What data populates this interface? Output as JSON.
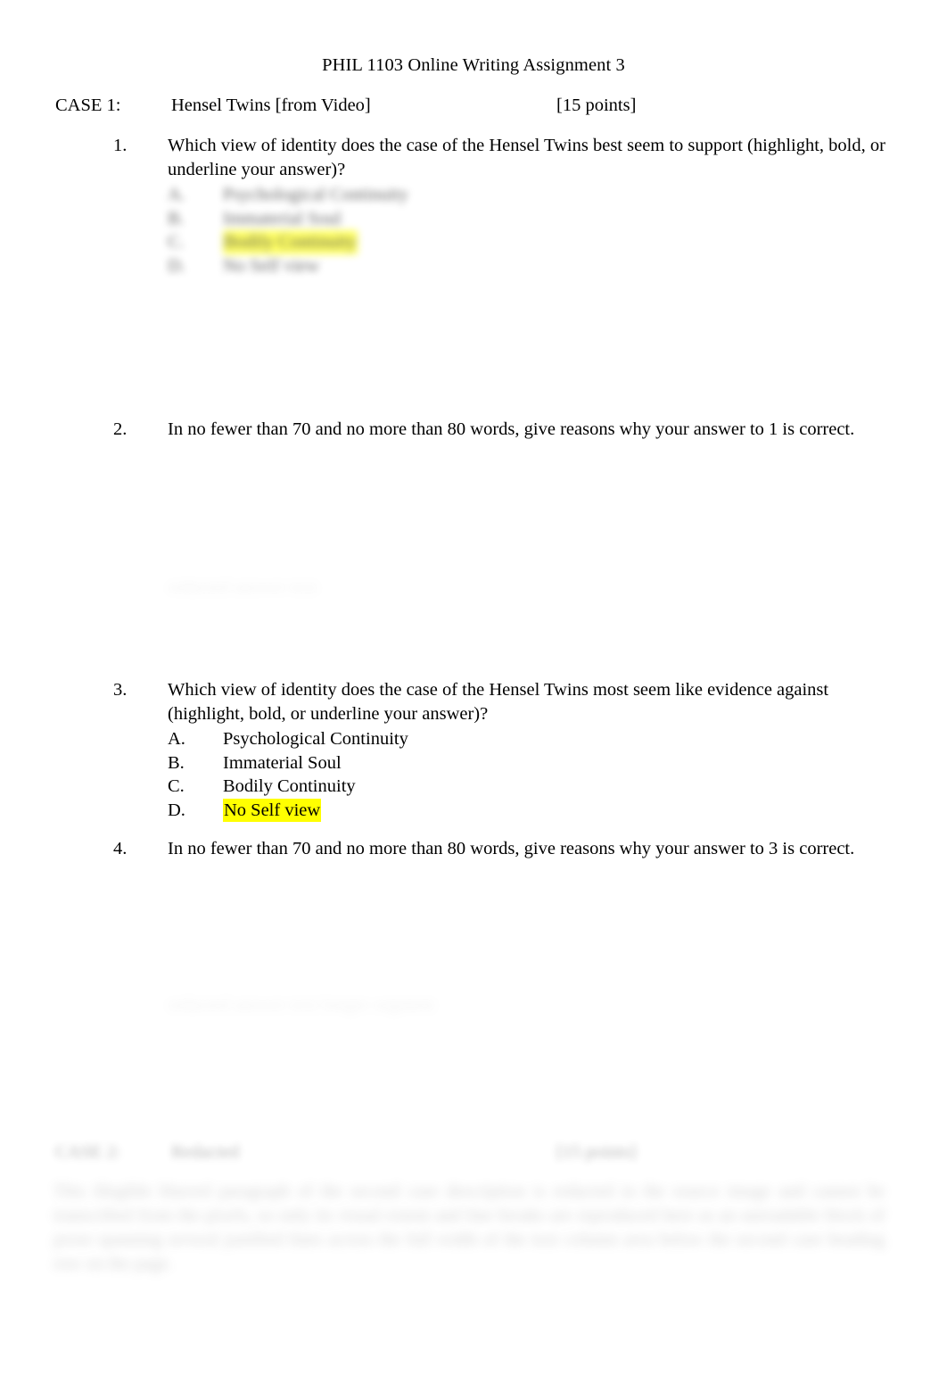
{
  "document": {
    "title": "PHIL 1103 Online Writing Assignment 3"
  },
  "case1": {
    "label": "CASE 1:",
    "name": "Hensel Twins [from Video]",
    "points": "[15 points]",
    "questions": [
      {
        "number": "1.",
        "text": "Which view of identity does the case of the Hensel Twins best seem to support (highlight, bold, or underline your answer)?",
        "options": [
          {
            "letter": "A.",
            "label": "Psychological Continuity",
            "highlighted": false
          },
          {
            "letter": "B.",
            "label": "Immaterial Soul",
            "highlighted": false
          },
          {
            "letter": "C.",
            "label": "Bodily Continuity",
            "highlighted": true
          },
          {
            "letter": "D.",
            "label": "No Self view",
            "highlighted": false
          }
        ],
        "answer_remnant": "redacted answer text"
      },
      {
        "number": "2.",
        "text": "In no fewer than 70 and no more than 80 words, give reasons why your answer to 1 is correct.",
        "answer_remnant": "redacted answer text"
      },
      {
        "number": "3.",
        "text": "Which view of identity does the case of the Hensel Twins most seem like evidence  against  (highlight, bold, or underline your answer)?",
        "options": [
          {
            "letter": "A.",
            "label": "Psychological Continuity",
            "highlighted": false
          },
          {
            "letter": "B.",
            "label": "Immaterial Soul",
            "highlighted": false
          },
          {
            "letter": "C.",
            "label": "Bodily Continuity",
            "highlighted": false
          },
          {
            "letter": "D.",
            "label": "No Self view",
            "highlighted": true
          }
        ]
      },
      {
        "number": "4.",
        "text": "In no fewer than 70 and no more than 80 words, give reasons why your answer to 3 is correct.",
        "answer_remnant": "redacted answer text longer segment"
      }
    ]
  },
  "case2": {
    "label": "CASE 2:",
    "name": "Redacted",
    "points": "[15 points]",
    "body": "This illegible blurred paragraph of the second case description is redacted in the source image and cannot be transcribed from the pixels, so only its visual extent and line breaks are reproduced here as an unreadable block of prose spanning several justified lines across the full width of the text column area below the second case heading row on the page."
  },
  "colors": {
    "highlight": "#ffff00",
    "text": "#000000",
    "page_background": "#ffffff"
  }
}
